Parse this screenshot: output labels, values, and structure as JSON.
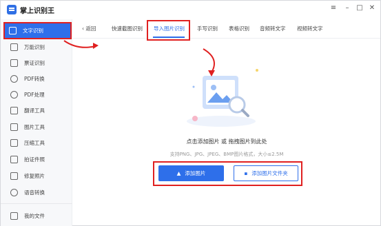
{
  "app": {
    "title": "掌上识别王"
  },
  "window_controls": {
    "menu": "≡",
    "minimize": "–",
    "maximize": "□",
    "close": "✕"
  },
  "sidebar": {
    "items": [
      {
        "label": "文字识别",
        "icon": "text-recognition-icon"
      },
      {
        "label": "万能识别",
        "icon": "camera-icon"
      },
      {
        "label": "票证识别",
        "icon": "ticket-icon"
      },
      {
        "label": "PDF转换",
        "icon": "pdf-icon"
      },
      {
        "label": "PDF处理",
        "icon": "pdf-process-icon"
      },
      {
        "label": "翻译工具",
        "icon": "translate-icon"
      },
      {
        "label": "图片工具",
        "icon": "image-icon"
      },
      {
        "label": "压缩工具",
        "icon": "compress-icon"
      },
      {
        "label": "拍证件照",
        "icon": "id-photo-icon"
      },
      {
        "label": "修复照片",
        "icon": "repair-photo-icon"
      },
      {
        "label": "语音转换",
        "icon": "voice-icon"
      }
    ],
    "footer": {
      "label": "我的文件",
      "icon": "folder-icon"
    }
  },
  "tabs": {
    "back": "返回",
    "items": [
      {
        "label": "快速截图识别"
      },
      {
        "label": "导入图片识别"
      },
      {
        "label": "手写识别"
      },
      {
        "label": "表格识别"
      },
      {
        "label": "音频转文字"
      },
      {
        "label": "视频转文字"
      }
    ]
  },
  "main": {
    "prompt": "点击添加图片 或 拖拽图片到此处",
    "hint": "支持PNG、JPG、JPEG、BMP图片格式，大小≤2.5M",
    "add_image_label": "添加图片",
    "add_folder_label": "添加图片文件夹"
  },
  "colors": {
    "accent": "#2e6fea",
    "highlight": "#e02020"
  }
}
